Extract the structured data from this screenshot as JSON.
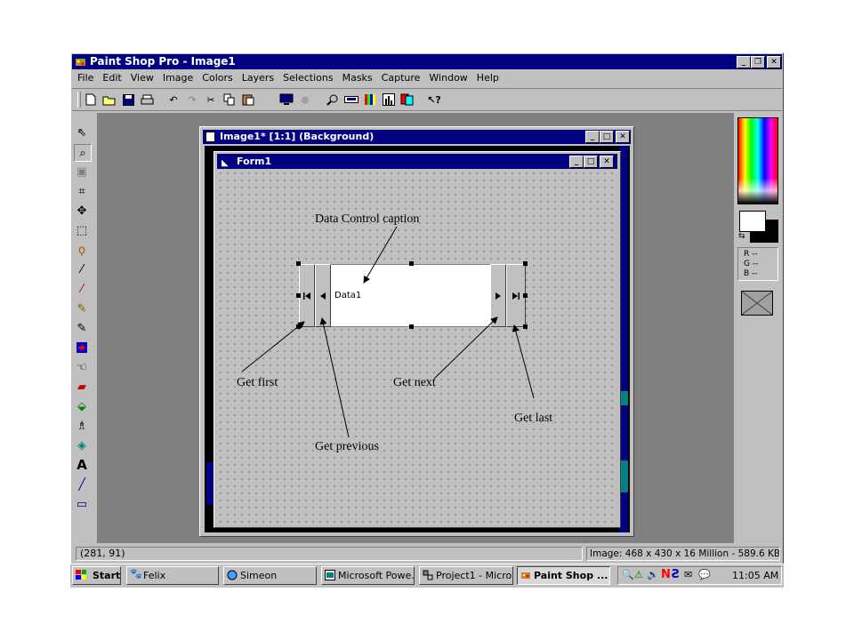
{
  "app": {
    "title": "Paint Shop Pro - Image1"
  },
  "menu": [
    "File",
    "Edit",
    "View",
    "Image",
    "Colors",
    "Layers",
    "Selections",
    "Masks",
    "Capture",
    "Window",
    "Help"
  ],
  "toolbar_icons": [
    "new-icon",
    "open-icon",
    "save-icon",
    "print-icon",
    "undo-icon",
    "redo-icon",
    "cut-icon",
    "copy-icon",
    "paste-icon",
    "capture-icon",
    "stop-icon",
    "zoom-icon",
    "ruler-icon",
    "palette-icon",
    "histogram-icon",
    "layers-icon",
    "help-icon"
  ],
  "image_window": {
    "title": "Image1* [1:1] (Background)"
  },
  "form_window": {
    "title": "Form1"
  },
  "data_control": {
    "caption": "Data1"
  },
  "annotations": {
    "caption": "Data Control caption",
    "first": "Get first",
    "previous": "Get previous",
    "next": "Get next",
    "last": "Get last"
  },
  "color_panel": {
    "r": "R --",
    "g": "G --",
    "b": "B --"
  },
  "status": {
    "coords": "(281, 91)",
    "image_info": "Image:  468 x 430 x 16 Million - 589.6 KBytes"
  },
  "taskbar": {
    "start": "Start",
    "items": [
      {
        "label": "Felix",
        "active": false
      },
      {
        "label": "Simeon",
        "active": false
      },
      {
        "label": "Microsoft Powe...",
        "active": false
      },
      {
        "label": "Project1 - Micro...",
        "active": false
      },
      {
        "label": "Paint Shop ...",
        "active": true
      }
    ],
    "clock": "11:05 AM"
  },
  "colors": {
    "titlebar": "#000080",
    "face": "#c0c0c0",
    "desktop": "#808080"
  }
}
